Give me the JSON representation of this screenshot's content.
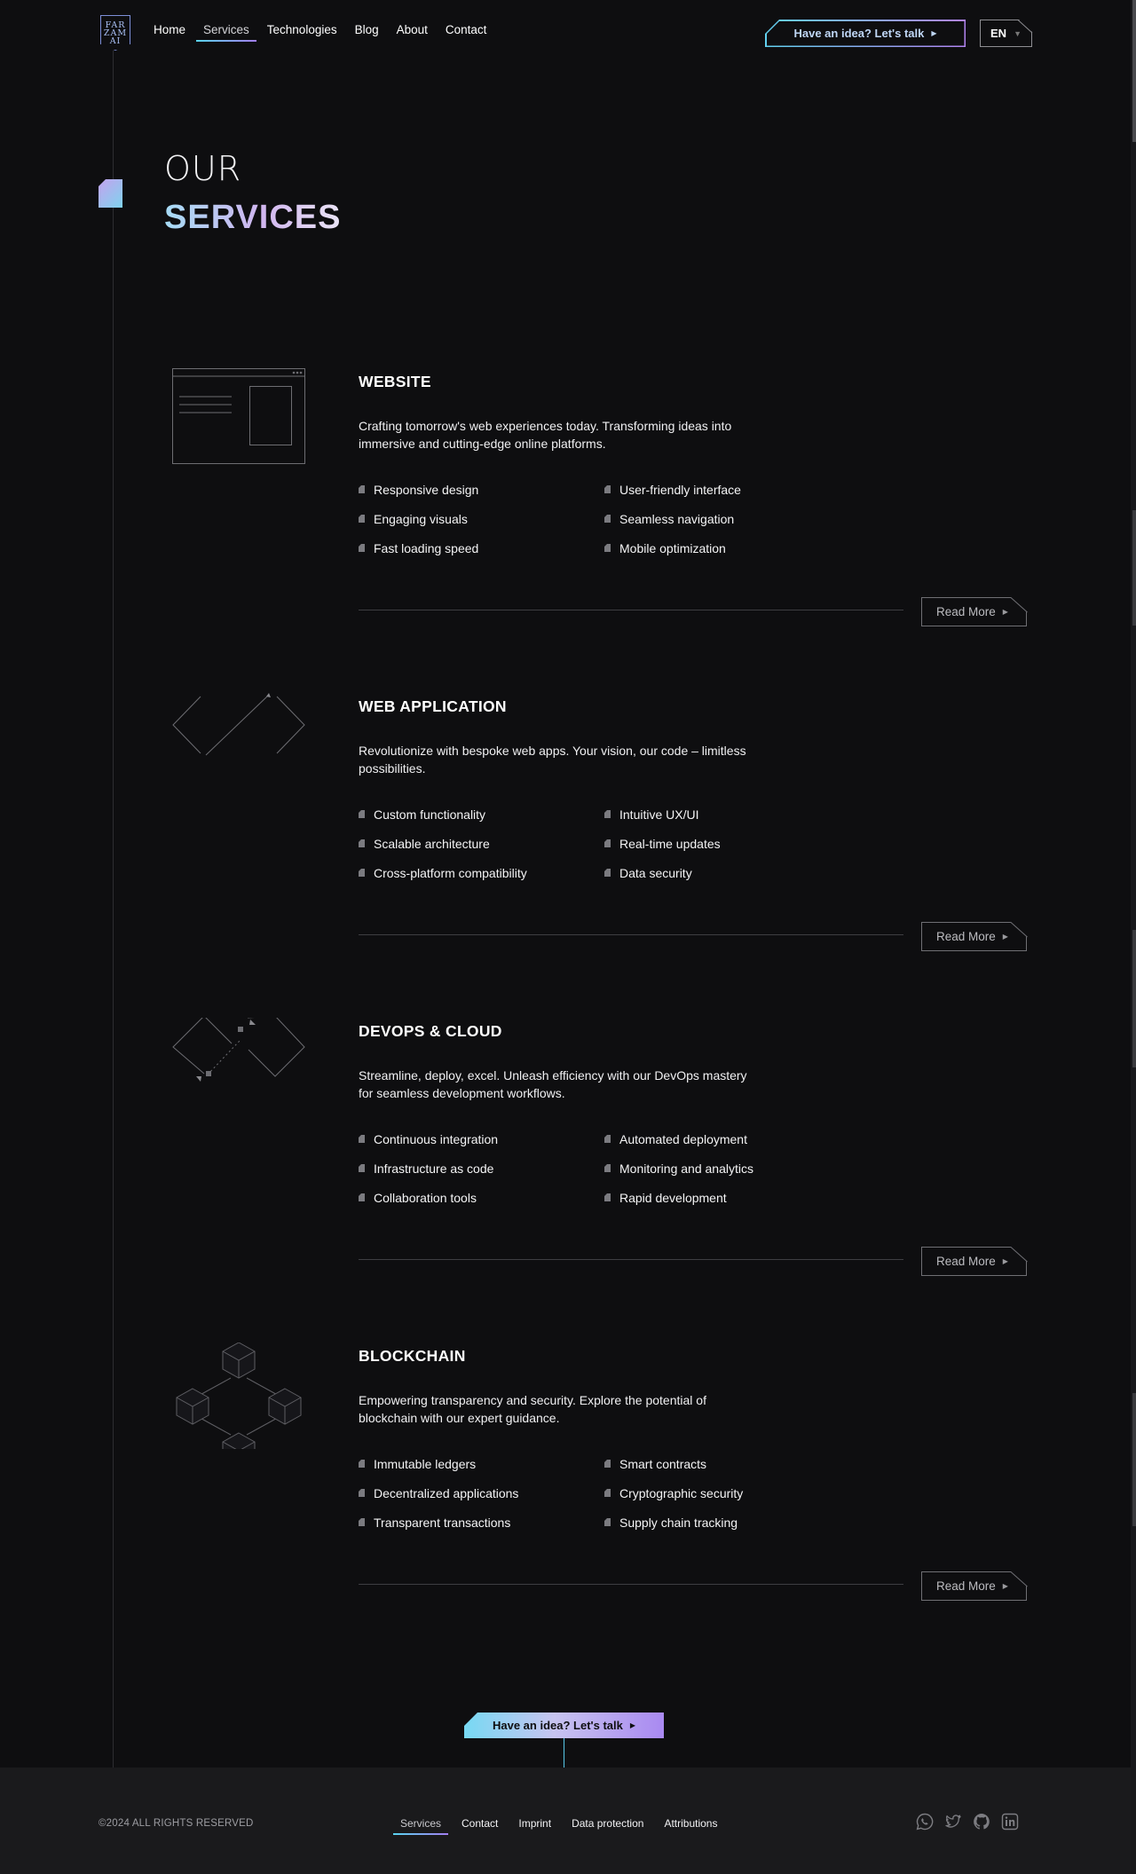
{
  "header": {
    "logo_lines": [
      "FAR",
      "ZAM",
      "AI"
    ],
    "nav": [
      {
        "label": "Home",
        "active": false
      },
      {
        "label": "Services",
        "active": true
      },
      {
        "label": "Technologies",
        "active": false
      },
      {
        "label": "Blog",
        "active": false
      },
      {
        "label": "About",
        "active": false
      },
      {
        "label": "Contact",
        "active": false
      }
    ],
    "cta_label": "Have an idea? Let's talk",
    "language": "EN"
  },
  "hero": {
    "line1": "OUR",
    "line2": "SERVICES"
  },
  "services": [
    {
      "icon": "browser-window-icon",
      "title": "WEBSITE",
      "description": "Crafting tomorrow's web experiences today. Transforming ideas into immersive and cutting-edge online platforms.",
      "features": [
        "Responsive design",
        "User-friendly interface",
        "Engaging visuals",
        "Seamless navigation",
        "Fast loading speed",
        "Mobile optimization"
      ],
      "read_more": "Read More"
    },
    {
      "icon": "code-brackets-icon",
      "title": "WEB APPLICATION",
      "description": "Revolutionize with bespoke web apps. Your vision, our code – limitless possibilities.",
      "features": [
        "Custom functionality",
        "Intuitive UX/UI",
        "Scalable architecture",
        "Real-time updates",
        "Cross-platform compatibility",
        "Data security"
      ],
      "read_more": "Read More"
    },
    {
      "icon": "infinity-loop-icon",
      "title": "DEVOPS & CLOUD",
      "description": "Streamline, deploy, excel. Unleash efficiency with our DevOps mastery for seamless development workflows.",
      "features": [
        "Continuous integration",
        "Automated deployment",
        "Infrastructure as code",
        "Monitoring and analytics",
        "Collaboration tools",
        "Rapid development"
      ],
      "read_more": "Read More"
    },
    {
      "icon": "blockchain-cubes-icon",
      "title": "BLOCKCHAIN",
      "description": "Empowering transparency and security. Explore the potential of blockchain with our expert guidance.",
      "features": [
        "Immutable ledgers",
        "Smart contracts",
        "Decentralized applications",
        "Cryptographic security",
        "Transparent transactions",
        "Supply chain tracking"
      ],
      "read_more": "Read More"
    }
  ],
  "bottom_cta": "Have an idea? Let's talk",
  "footer": {
    "copyright": "©2024 ALL RIGHTS RESERVED",
    "links": [
      {
        "label": "Services",
        "active": true
      },
      {
        "label": "Contact",
        "active": false
      },
      {
        "label": "Imprint",
        "active": false
      },
      {
        "label": "Data protection",
        "active": false
      },
      {
        "label": "Attributions",
        "active": false
      }
    ],
    "socials": [
      "whatsapp-icon",
      "twitter-icon",
      "github-icon",
      "linkedin-icon"
    ]
  },
  "colors": {
    "background": "#0e0e10",
    "footer_bg": "#1a1a1c",
    "accent_cyan": "#59d4f0",
    "accent_violet": "#a27ef0"
  }
}
